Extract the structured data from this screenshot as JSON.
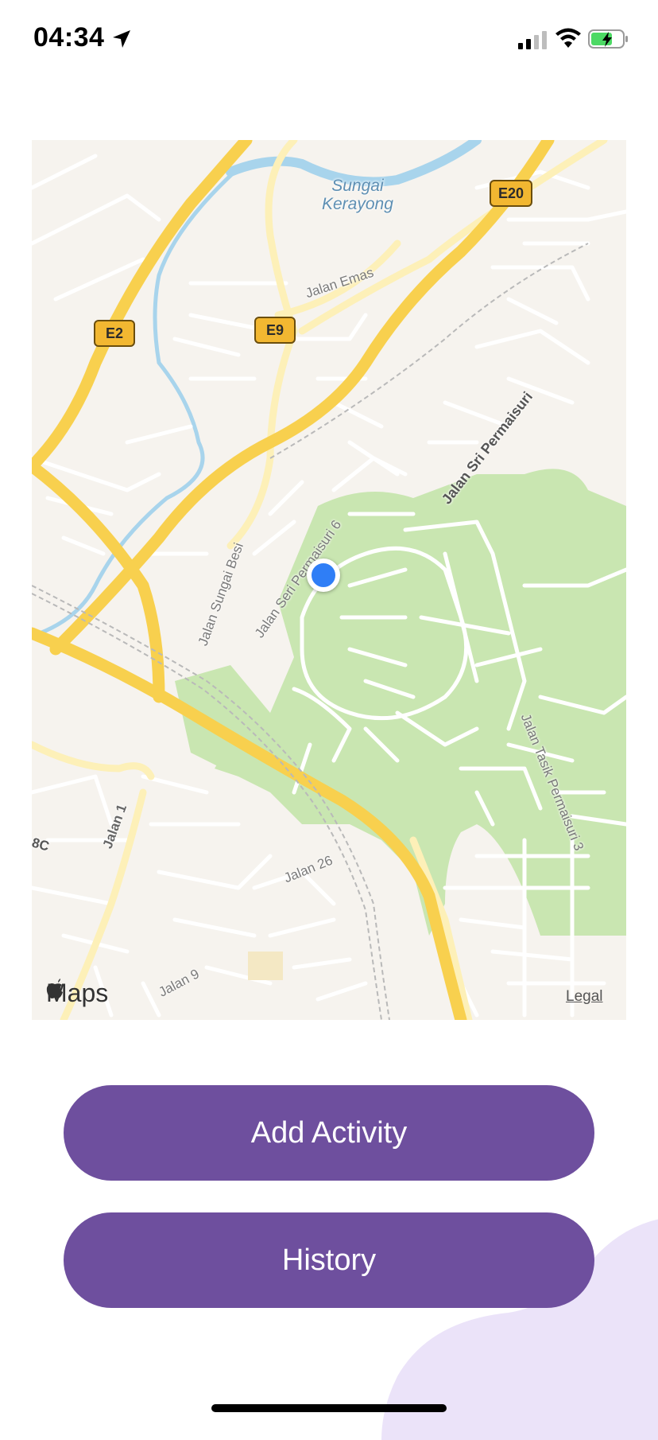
{
  "status_bar": {
    "time": "04:34",
    "icons": [
      "location-arrow-icon",
      "cellular-signal-icon",
      "wifi-icon",
      "battery-charging-icon"
    ]
  },
  "map": {
    "labels": {
      "sungai_kerayong": "Sungai\nKerayong",
      "jalan_emas": "Jalan Emas",
      "e20": "E20",
      "e2": "E2",
      "e9": "E9",
      "jalan_sri_permaisuri": "Jalan Sri Permaisuri",
      "jalan_seri_permaisuri_6": "Jalan Seri Permaisuri 6",
      "jalan_sungai_besi": "Jalan Sungai Besi",
      "jalan_tasik_permaisuri_3": "Jalan Tasik Permaisuri 3",
      "jalan_1": "Jalan 1",
      "jalan_26": "Jalan 26",
      "jalan_9": "Jalan 9",
      "label_8c": "8C"
    },
    "attribution": "Maps",
    "legal": "Legal",
    "colors": {
      "land": "#f6f3ee",
      "park": "#c9e6b1",
      "water": "#a8d4ec",
      "highway": "#f8d04e",
      "major_road": "#fdf0b8",
      "minor_road": "#ffffff",
      "user_location": "#2f7ef6"
    }
  },
  "actions": {
    "add_activity": "Add Activity",
    "history": "History"
  },
  "theme": {
    "button_color": "#6e4f9e",
    "blob_color": "#ebe3f9"
  }
}
